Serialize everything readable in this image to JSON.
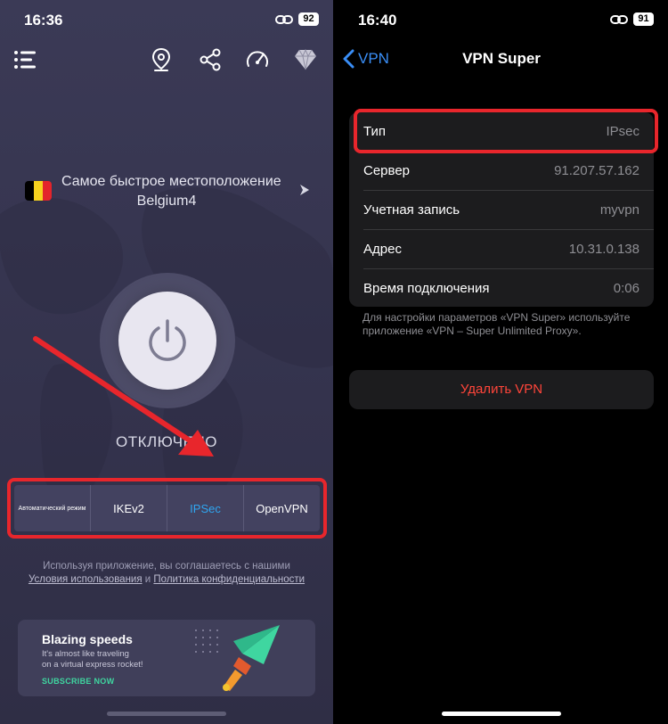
{
  "left": {
    "status": {
      "time": "16:36",
      "battery": "92"
    },
    "location": {
      "title": "Самое быстрое местоположение",
      "server": "Belgium4"
    },
    "connection_status": "ОТКЛЮЧЕНО",
    "protocols": [
      "Автоматический режим",
      "IKEv2",
      "IPSec",
      "OpenVPN"
    ],
    "selected_protocol": "IPSec",
    "terms": {
      "prefix": "Используя приложение, вы соглашаетесь с нашими ",
      "link1": "Условия использования",
      "middle": " и ",
      "link2": "Политика конфиденциальности"
    },
    "promo": {
      "title": "Blazing speeds",
      "line1": "It's almost like traveling",
      "line2": "on a virtual express rocket!",
      "cta": "SUBSCRIBE NOW"
    },
    "icons": [
      "menu-icon",
      "location-pin-icon",
      "share-icon",
      "speedometer-icon",
      "diamond-icon",
      "power-icon",
      "rocket-icon"
    ]
  },
  "right": {
    "status": {
      "time": "16:40",
      "battery": "91"
    },
    "nav": {
      "back_label": "VPN",
      "title": "VPN Super"
    },
    "rows": [
      {
        "key": "Тип",
        "value": "IPsec"
      },
      {
        "key": "Сервер",
        "value": "91.207.57.162"
      },
      {
        "key": "Учетная запись",
        "value": "myvpn"
      },
      {
        "key": "Адрес",
        "value": "10.31.0.138"
      },
      {
        "key": "Время подключения",
        "value": "0:06"
      }
    ],
    "footnote": "Для настройки параметров «VPN Super» используйте приложение «VPN – Super Unlimited Proxy».",
    "delete_label": "Удалить VPN"
  },
  "colors": {
    "accent_blue": "#2fa6f0",
    "ios_blue": "#3a8ef6",
    "highlight_red": "#e8262c",
    "destructive": "#ff453a",
    "promo_green": "#3fd6a0"
  }
}
